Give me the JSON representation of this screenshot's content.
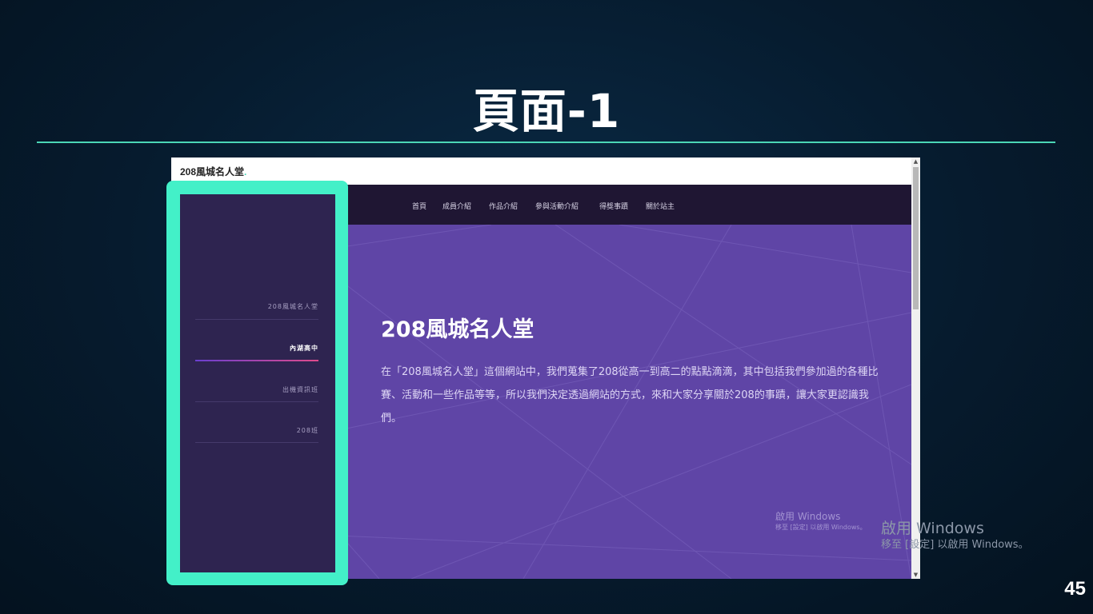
{
  "slide": {
    "title": "頁面-1",
    "page_number": "45"
  },
  "site": {
    "brand": "208風城名人堂",
    "brand_dot": ".",
    "nav": [
      {
        "label": "首頁"
      },
      {
        "label": "成員介紹"
      },
      {
        "label": "作品介紹"
      },
      {
        "label": "參與活動介紹"
      },
      {
        "label": "得獎事蹟"
      },
      {
        "label": "關於站主"
      }
    ],
    "hero": {
      "title": "208風城名人堂",
      "text": "在「208風城名人堂」這個網站中，我們蒐集了208從高一到高二的點點滴滴，其中包括我們參加過的各種比賽、活動和一些作品等等，所以我們決定透過網站的方式，來和大家分享關於208的事蹟，讓大家更認識我們。"
    },
    "sidebar": {
      "items": [
        {
          "label": "208風城名人堂",
          "active": false
        },
        {
          "label": "內湖高中",
          "active": true
        },
        {
          "label": "出機資訊班",
          "active": false
        },
        {
          "label": "208班",
          "active": false
        }
      ]
    },
    "watermark": {
      "title": "啟用 Windows",
      "subtitle": "移至 [設定] 以啟用 Windows。"
    }
  },
  "desktop_watermark": {
    "title": "啟用 Windows",
    "subtitle": "移至 [設定] 以啟用 Windows。"
  },
  "colors": {
    "accent": "#43f0c8",
    "hero_bg": "#5f45a6",
    "navbar_bg": "#1f1633",
    "sidebar_bg": "#2e2450"
  }
}
